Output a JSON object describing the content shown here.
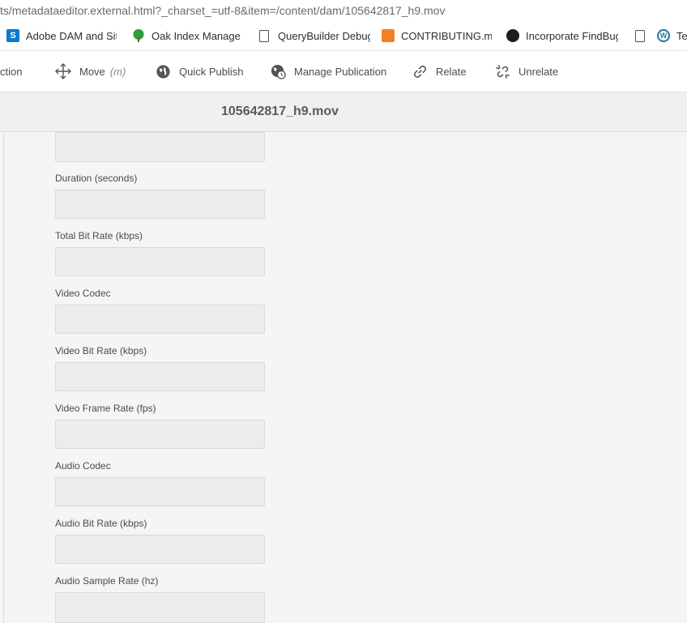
{
  "browser": {
    "url": "ts/metadataeditor.external.html?_charset_=utf-8&item=/content/dam/105642817_h9.mov",
    "bookmarks": [
      {
        "label": "Adobe DAM and Site",
        "icon": "sharepoint-icon"
      },
      {
        "label": "Oak Index Manager |",
        "icon": "tree-icon"
      },
      {
        "label": "QueryBuilder Debugg",
        "icon": "page-icon"
      },
      {
        "label": "CONTRIBUTING.md -",
        "icon": "stackoverflow-icon"
      },
      {
        "label": "Incorporate FindBugs",
        "icon": "github-icon"
      },
      {
        "label": "",
        "icon": "page-icon"
      },
      {
        "label": "Tes",
        "icon": "wordpress-icon"
      }
    ]
  },
  "toolbar": {
    "items": [
      {
        "label": "ction",
        "icon": ""
      },
      {
        "label": "Move",
        "hint": "(m)",
        "icon": "move-icon"
      },
      {
        "label": "Quick Publish",
        "icon": "globe-icon"
      },
      {
        "label": "Manage Publication",
        "icon": "globe-clock-icon"
      },
      {
        "label": "Relate",
        "icon": "link-icon"
      },
      {
        "label": "Unrelate",
        "icon": "unlink-icon"
      }
    ]
  },
  "header": {
    "title": "105642817_h9.mov"
  },
  "form": {
    "fields": [
      {
        "label": "",
        "value": ""
      },
      {
        "label": "Duration (seconds)",
        "value": ""
      },
      {
        "label": "Total Bit Rate (kbps)",
        "value": ""
      },
      {
        "label": "Video Codec",
        "value": ""
      },
      {
        "label": "Video Bit Rate (kbps)",
        "value": ""
      },
      {
        "label": "Video Frame Rate (fps)",
        "value": ""
      },
      {
        "label": "Audio Codec",
        "value": ""
      },
      {
        "label": "Audio Bit Rate (kbps)",
        "value": ""
      },
      {
        "label": "Audio Sample Rate (hz)",
        "value": ""
      }
    ]
  },
  "colors": {
    "accent_sharepoint": "#0f78c9",
    "accent_stackoverflow": "#f48024",
    "accent_wordpress": "#21759b"
  }
}
